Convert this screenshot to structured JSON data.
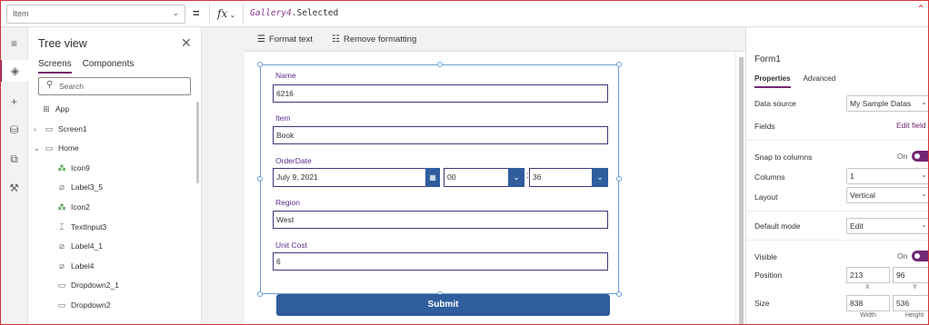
{
  "formula_bar": {
    "property": "Item",
    "equals": "=",
    "fx": "fx",
    "formula_ident": "Gallery4",
    "formula_rest": ".Selected"
  },
  "tree": {
    "title": "Tree view",
    "tabs": [
      "Screens",
      "Components"
    ],
    "search_placeholder": "Search",
    "items": [
      {
        "label": "App",
        "icon": "app-icon",
        "indent": 0,
        "chevron": ""
      },
      {
        "label": "Screen1",
        "icon": "screen-icon",
        "indent": 1,
        "chevron": "›"
      },
      {
        "label": "Home",
        "icon": "screen-icon",
        "indent": 1,
        "chevron": "⌄"
      },
      {
        "label": "Icon9",
        "icon": "shapes-icon",
        "indent": 2,
        "chevron": ""
      },
      {
        "label": "Label3_5",
        "icon": "label-icon",
        "indent": 2,
        "chevron": ""
      },
      {
        "label": "Icon2",
        "icon": "shapes-icon",
        "indent": 2,
        "chevron": ""
      },
      {
        "label": "TextInput3",
        "icon": "textinput-icon",
        "indent": 2,
        "chevron": ""
      },
      {
        "label": "Label4_1",
        "icon": "label-icon",
        "indent": 2,
        "chevron": ""
      },
      {
        "label": "Label4",
        "icon": "label-icon",
        "indent": 2,
        "chevron": ""
      },
      {
        "label": "Dropdown2_1",
        "icon": "dropdown-icon",
        "indent": 2,
        "chevron": ""
      },
      {
        "label": "Dropdown2",
        "icon": "dropdown-icon",
        "indent": 2,
        "chevron": ""
      }
    ]
  },
  "toolbar": {
    "format_text": "Format text",
    "remove_formatting": "Remove formatting"
  },
  "form": {
    "name_label": "Name",
    "name_value": "6216",
    "item_label": "Item",
    "item_value": "Book",
    "orderdate_label": "OrderDate",
    "date_value": "July 9, 2021",
    "hour_value": "00",
    "minute_value": "36",
    "time_sep": ":",
    "region_label": "Region",
    "region_value": "West",
    "unitcost_label": "Unit Cost",
    "unitcost_value": "6",
    "submit_label": "Submit"
  },
  "properties": {
    "control_name": "Form1",
    "tabs": [
      "Properties",
      "Advanced"
    ],
    "data_source_label": "Data source",
    "data_source_value": "My Sample Datas",
    "fields_label": "Fields",
    "fields_link": "Edit field",
    "snap_label": "Snap to columns",
    "snap_state": "On",
    "columns_label": "Columns",
    "columns_value": "1",
    "layout_label": "Layout",
    "layout_value": "Vertical",
    "default_mode_label": "Default mode",
    "default_mode_value": "Edit",
    "visible_label": "Visible",
    "visible_state": "On",
    "position_label": "Position",
    "position_x": "213",
    "position_y": "96",
    "x_caption": "X",
    "y_caption": "Y",
    "size_label": "Size",
    "width_value": "838",
    "height_value": "536",
    "width_caption": "Width",
    "height_caption": "Height"
  }
}
